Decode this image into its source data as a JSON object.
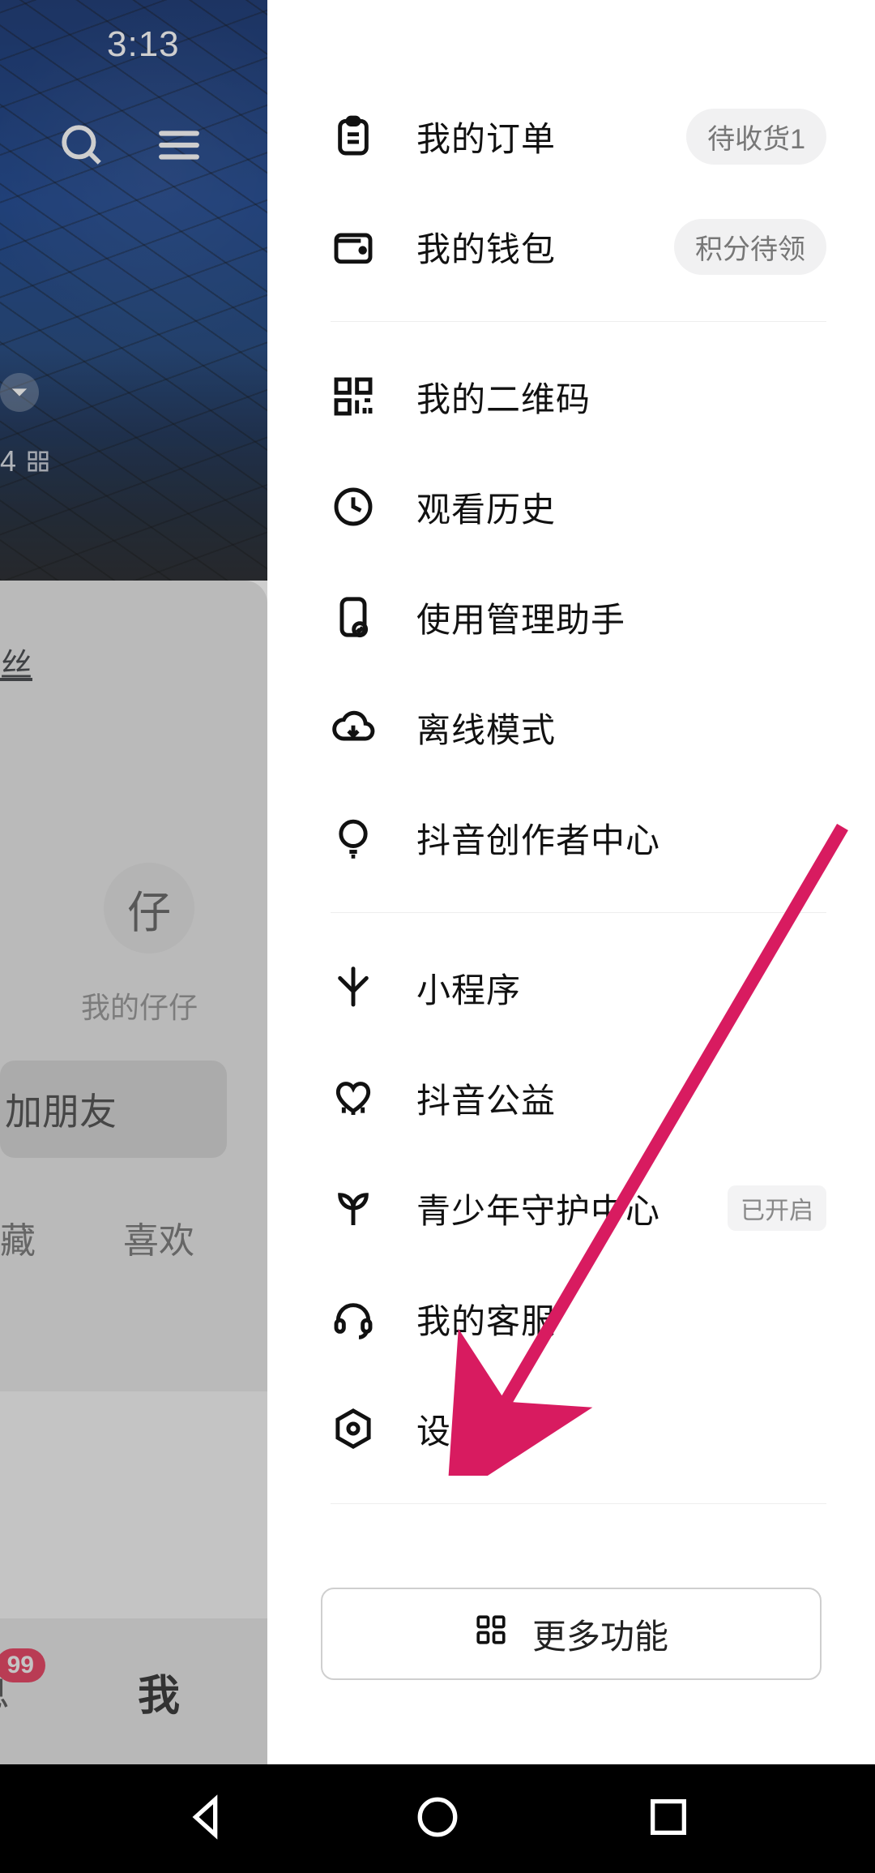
{
  "status": {
    "time": "3:13"
  },
  "left": {
    "meta_number": "4",
    "fans_label": "丝",
    "avatar_glyph": "仔",
    "avatar_label": "我的仔仔",
    "friend_btn": "加朋友",
    "tab_fav": "藏",
    "tab_like": "喜欢",
    "nav_msg": "息",
    "nav_msg_badge": "99",
    "nav_me": "我"
  },
  "drawer": {
    "section1": [
      {
        "id": "orders",
        "label": "我的订单",
        "chip": "待收货1"
      },
      {
        "id": "wallet",
        "label": "我的钱包",
        "chip": "积分待领"
      }
    ],
    "section2": [
      {
        "id": "qrcode",
        "label": "我的二维码"
      },
      {
        "id": "history",
        "label": "观看历史"
      },
      {
        "id": "usage",
        "label": "使用管理助手"
      },
      {
        "id": "offline",
        "label": "离线模式"
      },
      {
        "id": "creator",
        "label": "抖音创作者中心"
      }
    ],
    "section3": [
      {
        "id": "miniapp",
        "label": "小程序"
      },
      {
        "id": "charity",
        "label": "抖音公益"
      },
      {
        "id": "youth",
        "label": "青少年守护中心",
        "tag": "已开启"
      },
      {
        "id": "support",
        "label": "我的客服"
      },
      {
        "id": "settings",
        "label": "设置"
      }
    ],
    "more_btn": "更多功能"
  }
}
